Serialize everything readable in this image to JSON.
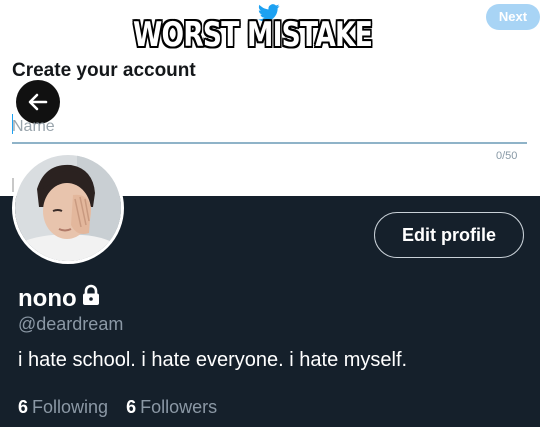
{
  "meme": {
    "caption": "WORST MISTAKE"
  },
  "signup": {
    "title": "Create your account",
    "next_label": "Next",
    "name_placeholder": "Name",
    "char_count": "0/50"
  },
  "profile": {
    "edit_label": "Edit profile",
    "display_name": "nono",
    "handle": "@deardream",
    "bio": "i hate school. i hate everyone. i hate myself.",
    "following_count": "6",
    "following_label": "Following",
    "followers_count": "6",
    "followers_label": "Followers"
  },
  "icons": {
    "bird": "twitter-bird-icon",
    "back": "arrow-left-icon",
    "lock": "lock-icon"
  },
  "colors": {
    "accent": "#1da1f2",
    "dark_bg": "#15202b",
    "secondary_text": "#8b98a5",
    "next_button": "#a8d4f5"
  }
}
